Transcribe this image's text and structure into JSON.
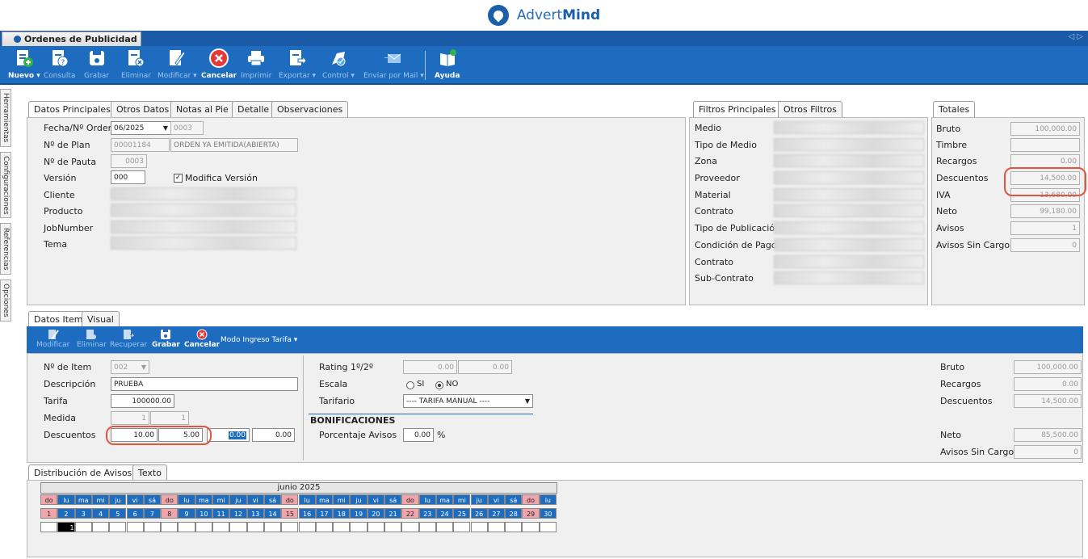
{
  "brand": {
    "name_a": "Advert",
    "name_b": "Mind"
  },
  "window": {
    "tab_title": "Ordenes de Publicidad",
    "controls": "◁ ▷"
  },
  "toolbar": {
    "nuevo": "Nuevo ▾",
    "consulta": "Consulta",
    "grabar": "Grabar",
    "eliminar": "Eliminar",
    "modificar": "Modificar ▾",
    "cancelar": "Cancelar",
    "imprimir": "Imprimir",
    "exportar": "Exportar ▾",
    "control": "Control ▾",
    "enviar": "Enviar por Mail ▾",
    "ayuda": "Ayuda"
  },
  "side_tabs": [
    "Herramientas",
    "Configuraciones",
    "Referencias",
    "Opciones"
  ],
  "main_tabs": [
    "Datos Principales",
    "Otros Datos",
    "Notas al Pie",
    "Detalle",
    "Observaciones"
  ],
  "main": {
    "fecha_label": "Fecha/Nº Orden",
    "fecha_value": "06/2025",
    "orden_value": "0003",
    "plan_label": "Nº de Plan",
    "plan_value": "00001184",
    "plan_status": "ORDEN YA EMITIDA(ABIERTA)",
    "pauta_label": "Nº de Pauta",
    "pauta_value": "0003",
    "version_label": "Versión",
    "version_value": "000",
    "modifica_label": "Modifica Versión",
    "cliente_label": "Cliente",
    "producto_label": "Producto",
    "jobnumber_label": "JobNumber",
    "tema_label": "Tema"
  },
  "filtros_tabs": [
    "Filtros Principales",
    "Otros Filtros"
  ],
  "filtros": [
    "Medio",
    "Tipo de Medio",
    "Zona",
    "Proveedor",
    "Material",
    "Contrato",
    "Tipo de Publicación",
    "Condición de Pago",
    "Contrato",
    "Sub-Contrato"
  ],
  "totales_tab": "Totales",
  "totales": [
    {
      "label": "Bruto",
      "value": "100,000.00"
    },
    {
      "label": "Timbre",
      "value": ""
    },
    {
      "label": "Recargos",
      "value": "0.00"
    },
    {
      "label": "Descuentos",
      "value": "14,500.00"
    },
    {
      "label": "IVA",
      "value": "13,680.00"
    },
    {
      "label": "Neto",
      "value": "99,180.00"
    },
    {
      "label": "Avisos",
      "value": "1"
    },
    {
      "label": "Avisos Sin Cargo",
      "value": "0"
    }
  ],
  "item_tabs": [
    "Datos Item",
    "Visual"
  ],
  "item_toolbar": {
    "modificar": "Modificar",
    "eliminar": "Eliminar",
    "recuperar": "Recuperar",
    "grabar": "Grabar",
    "cancelar": "Cancelar",
    "modo": "Modo Ingreso Tarifa ▾"
  },
  "item": {
    "nitem_label": "Nº de Item",
    "nitem_value": "002",
    "desc_label": "Descripción",
    "desc_value": "PRUEBA",
    "tarifa_label": "Tarifa",
    "tarifa_value": "100000.00",
    "medida_label": "Medida",
    "medida_1": "1",
    "medida_2": "1",
    "desc2_label": "Descuentos",
    "d1": "10.00",
    "d2": "5.00",
    "d3": "0.00",
    "d4": "0.00",
    "rating_label": "Rating 1º/2º",
    "rating_1": "0.00",
    "rating_2": "0.00",
    "escala_label": "Escala",
    "si": "SI",
    "no": "NO",
    "tarifario_label": "Tarifario",
    "tarifario_value": "---- TARIFA MANUAL ----",
    "bonif_label": "BONIFICACIONES",
    "porc_label": "Porcentaje Avisos",
    "porc_value": "0.00",
    "porc_unit": "%"
  },
  "item_totales": [
    {
      "label": "Bruto",
      "value": "100,000.00"
    },
    {
      "label": "Recargos",
      "value": "0.00"
    },
    {
      "label": "Descuentos",
      "value": "14,500.00"
    },
    {
      "label": "Neto",
      "value": "85,500.00"
    },
    {
      "label": "Avisos Sin Cargo",
      "value": "0"
    }
  ],
  "dist_tabs": [
    "Distribución de Avisos",
    "Texto"
  ],
  "calendar": {
    "month": "junio 2025",
    "weekdays": [
      "do",
      "lu",
      "ma",
      "mi",
      "ju",
      "vi",
      "sá",
      "do",
      "lu",
      "ma",
      "mi",
      "ju",
      "vi",
      "sá",
      "do",
      "lu",
      "ma",
      "mi",
      "ju",
      "vi",
      "sá",
      "do",
      "lu",
      "ma",
      "mi",
      "ju",
      "vi",
      "sá",
      "do",
      "lu"
    ],
    "days": [
      "1",
      "2",
      "3",
      "4",
      "5",
      "6",
      "7",
      "8",
      "9",
      "10",
      "11",
      "12",
      "13",
      "14",
      "15",
      "16",
      "17",
      "18",
      "19",
      "20",
      "21",
      "22",
      "23",
      "24",
      "25",
      "26",
      "27",
      "28",
      "29",
      "30"
    ],
    "selected_value": "1"
  }
}
